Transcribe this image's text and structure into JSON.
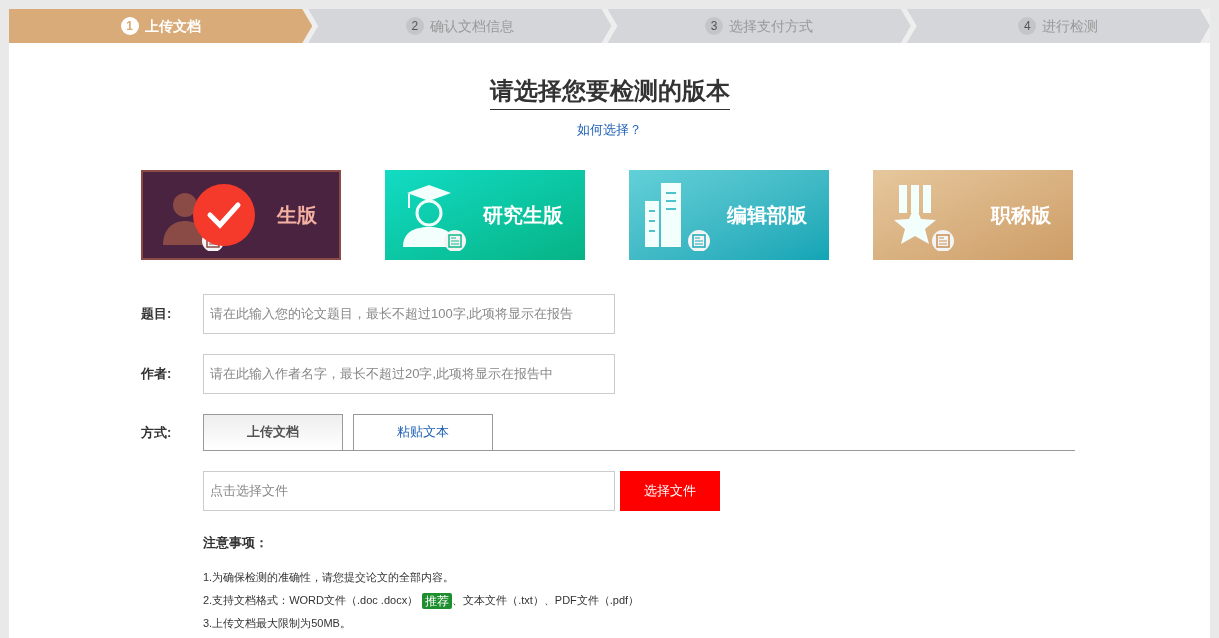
{
  "steps": [
    {
      "number": "1",
      "label": "上传文档",
      "selected": true
    },
    {
      "number": "2",
      "label": "确认文档信息",
      "selected": false
    },
    {
      "number": "3",
      "label": "选择支付方式",
      "selected": false
    },
    {
      "number": "4",
      "label": "进行检测",
      "selected": false
    }
  ],
  "heading": "请选择您要检测的版本",
  "help_link": "如何选择？",
  "versions": [
    {
      "kind": "student",
      "label": "生版",
      "selected": true
    },
    {
      "kind": "graduate",
      "label": "研究生版",
      "selected": false
    },
    {
      "kind": "editorial",
      "label": "编辑部版",
      "selected": false
    },
    {
      "kind": "title",
      "label": "职称版",
      "selected": false
    }
  ],
  "fields": [
    {
      "label": "题目:",
      "placeholder": "请在此输入您的论文题目，最长不超过100字,此项将显示在报告"
    },
    {
      "label": "作者:",
      "placeholder": "请在此输入作者名字，最长不超过20字,此项将显示在报告中"
    }
  ],
  "mode": {
    "label": "方式:",
    "tabs": [
      {
        "label": "上传文档",
        "selected": true
      },
      {
        "label": "粘贴文本",
        "selected": false
      }
    ]
  },
  "file": {
    "placeholder": "点击选择文件",
    "button": "选择文件"
  },
  "notes": {
    "title": "注意事项：",
    "items": [
      {
        "before": "1.为确保检测的准确性，请您提交论文的全部内容。"
      },
      {
        "before": "2.支持文档格式：WORD文件（.doc .docx）",
        "badge": "推荐",
        "after": "、文本文件（.txt）、PDF文件（.pdf）"
      },
      {
        "before": "3.上传文档最大限制为50MB。"
      }
    ]
  }
}
